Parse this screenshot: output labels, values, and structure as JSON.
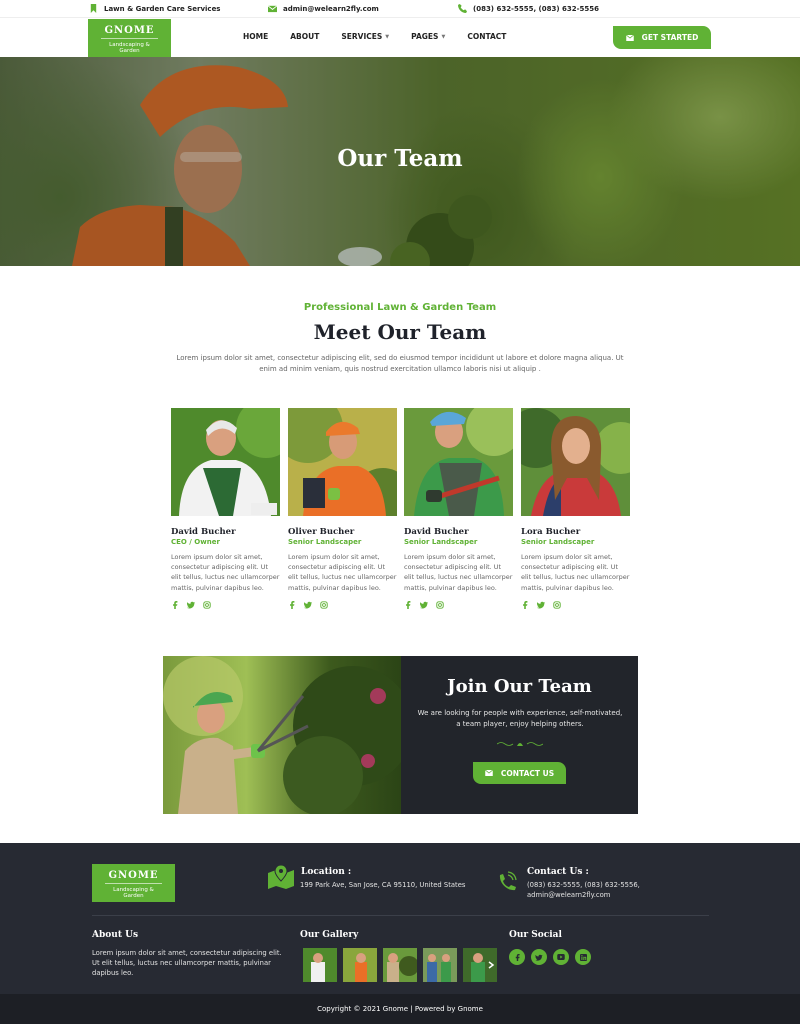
{
  "topbar": {
    "tagline": "Lawn & Garden Care Services",
    "email": "admin@welearn2fly.com",
    "phone": "(083) 632-5555, (083) 632-5556"
  },
  "brand": {
    "name": "GNOME",
    "sub": "Landscaping & Garden",
    "accent": "#60b235",
    "dark": "#272a33"
  },
  "nav": {
    "items": [
      "HOME",
      "ABOUT",
      "SERVICES",
      "PAGES",
      "CONTACT"
    ],
    "cta": "GET STARTED"
  },
  "hero": {
    "title": "Our Team"
  },
  "meet": {
    "subtitle": "Professional Lawn & Garden Team",
    "title": "Meet Our Team",
    "desc": "Lorem ipsum dolor sit amet, consectetur adipiscing elit, sed do eiusmod tempor incididunt ut labore et dolore magna aliqua. Ut enim ad minim veniam, quis nostrud exercitation ullamco laboris nisi ut aliquip ."
  },
  "team": [
    {
      "name": "David Bucher",
      "role": "CEO / Owner",
      "bio": "Lorem ipsum dolor sit amet, consectetur adipiscing elit. Ut elit tellus, luctus nec ullamcorper mattis, pulvinar dapibus leo."
    },
    {
      "name": "Oliver Bucher",
      "role": "Senior Landscaper",
      "bio": "Lorem ipsum dolor sit amet, consectetur adipiscing elit. Ut elit tellus, luctus nec ullamcorper mattis, pulvinar dapibus leo."
    },
    {
      "name": "David Bucher",
      "role": "Senior Landscaper",
      "bio": "Lorem ipsum dolor sit amet, consectetur adipiscing elit. Ut elit tellus, luctus nec ullamcorper mattis, pulvinar dapibus leo."
    },
    {
      "name": "Lora Bucher",
      "role": "Senior Landscaper",
      "bio": "Lorem ipsum dolor sit amet, consectetur adipiscing elit. Ut elit tellus, luctus nec ullamcorper mattis, pulvinar dapibus leo."
    }
  ],
  "social_icons": [
    "facebook-icon",
    "twitter-icon",
    "instagram-icon"
  ],
  "join": {
    "title": "Join Our Team",
    "desc": "We are looking for people with experience, self-motivated, a team player, enjoy helping others.",
    "cta": "CONTACT US"
  },
  "footer": {
    "location_title": "Location :",
    "location": "199 Park Ave, San Jose, CA 95110, United States",
    "contact_title": "Contact Us :",
    "contact_phone": "(083) 632-5555, (083) 632-5556,",
    "contact_email": "admin@welearn2fly.com",
    "about_title": "About Us",
    "about": "Lorem ipsum dolor sit amet, consectetur adipiscing elit. Ut elit tellus, luctus nec ullamcorper mattis, pulvinar dapibus leo.",
    "gallery_title": "Our Gallery",
    "social_title": "Our Social",
    "social_icons": [
      "facebook-icon",
      "twitter-icon",
      "youtube-icon",
      "linkedin-icon"
    ],
    "copyright": "Copyright © 2021 Gnome | Powered by Gnome"
  }
}
